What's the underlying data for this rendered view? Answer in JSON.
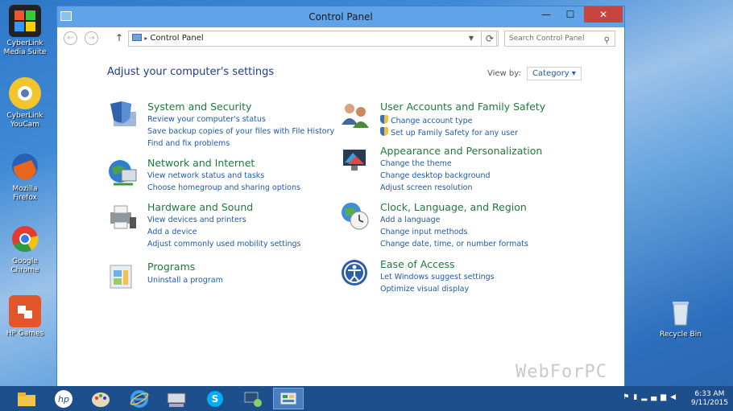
{
  "desktop": {
    "icons": [
      {
        "label": "CyberLink Media Suite",
        "icon": "cyberlink-icon"
      },
      {
        "label": "CyberLink YouCam",
        "icon": "youcam-icon"
      },
      {
        "label": "Mozilla Firefox",
        "icon": "firefox-icon"
      },
      {
        "label": "Google Chrome",
        "icon": "chrome-icon"
      },
      {
        "label": "HP Games",
        "icon": "hp-games-icon"
      },
      {
        "label": "Recycle Bin",
        "icon": "recycle-bin-icon"
      }
    ],
    "watermark": "WebForPC"
  },
  "window": {
    "title": "Control Panel",
    "address": "Control Panel",
    "search_placeholder": "Search Control Panel",
    "heading": "Adjust your computer's settings",
    "view_by_label": "View by:",
    "view_by_value": "Category",
    "categories": [
      {
        "title": "System and Security",
        "icon": "shield-system-icon",
        "links": [
          "Review your computer's status",
          "Save backup copies of your files with File History",
          "Find and fix problems"
        ]
      },
      {
        "title": "Network and Internet",
        "icon": "globe-network-icon",
        "links": [
          "View network status and tasks",
          "Choose homegroup and sharing options"
        ]
      },
      {
        "title": "Hardware and Sound",
        "icon": "printer-icon",
        "links": [
          "View devices and printers",
          "Add a device",
          "Adjust commonly used mobility settings"
        ]
      },
      {
        "title": "Programs",
        "icon": "programs-icon",
        "links": [
          "Uninstall a program"
        ]
      },
      {
        "title": "User Accounts and Family Safety",
        "icon": "users-icon",
        "links": [
          "Change account type",
          "Set up Family Safety for any user"
        ]
      },
      {
        "title": "Appearance and Personalization",
        "icon": "monitor-icon",
        "links": [
          "Change the theme",
          "Change desktop background",
          "Adjust screen resolution"
        ]
      },
      {
        "title": "Clock, Language, and Region",
        "icon": "clock-globe-icon",
        "links": [
          "Add a language",
          "Change input methods",
          "Change date, time, or number formats"
        ]
      },
      {
        "title": "Ease of Access",
        "icon": "ease-access-icon",
        "links": [
          "Let Windows suggest settings",
          "Optimize visual display"
        ]
      }
    ]
  },
  "taskbar": {
    "items": [
      "file-explorer-icon",
      "hp-icon",
      "paint-icon",
      "internet-explorer-icon",
      "keyboard-icon",
      "skype-icon",
      "network-icon",
      "control-panel-icon"
    ],
    "time": "6:33 AM",
    "date": "9/11/2015"
  }
}
